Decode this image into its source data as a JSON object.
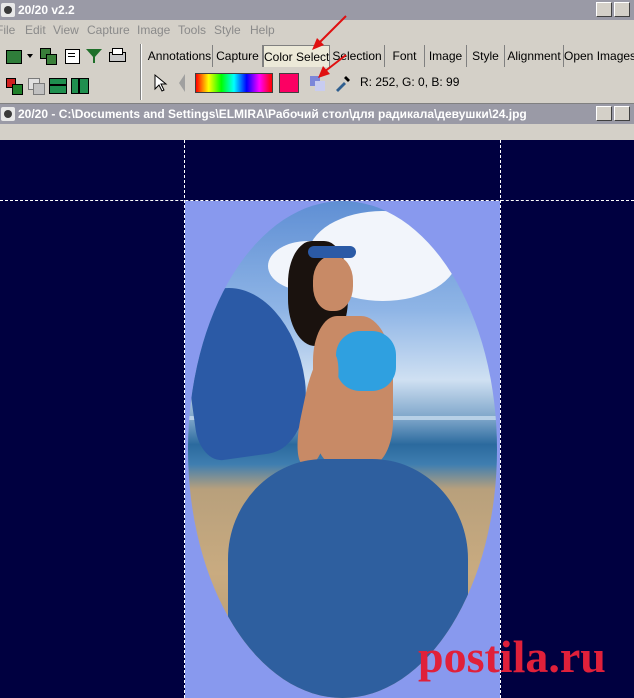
{
  "app_window": {
    "title": "20/20  v2.2"
  },
  "menu": {
    "items": [
      "File",
      "Edit",
      "View",
      "Capture",
      "Image",
      "Tools",
      "Style",
      "Help"
    ]
  },
  "toolbar": {
    "left_icons": [
      "export-icon",
      "transfer-icon",
      "copy-icon",
      "filter-icon",
      "print-icon",
      "color-replace-icon",
      "duplicate-icon",
      "horizontal-split-icon",
      "vertical-split-icon"
    ]
  },
  "tabs": [
    {
      "label": "Annotations"
    },
    {
      "label": "Capture"
    },
    {
      "label": "Color Select"
    },
    {
      "label": "Selection"
    },
    {
      "label": "Font"
    },
    {
      "label": "Image"
    },
    {
      "label": "Style"
    },
    {
      "label": "Alignment"
    },
    {
      "label": "Open Images"
    }
  ],
  "active_tab": "Color Select",
  "color_select": {
    "current_color": "#fc0063",
    "rgb_readout": "R: 252, G: 0, B: 99"
  },
  "image_window": {
    "title": "20/20 - C:\\Documents and Settings\\ELMIRA\\Рабочий стол\\для радикала\\девушки\\24.jpg"
  },
  "canvas": {
    "background_color": "#000040",
    "fill_color": "#8899ee"
  },
  "watermark": {
    "text": "postila.ru"
  }
}
